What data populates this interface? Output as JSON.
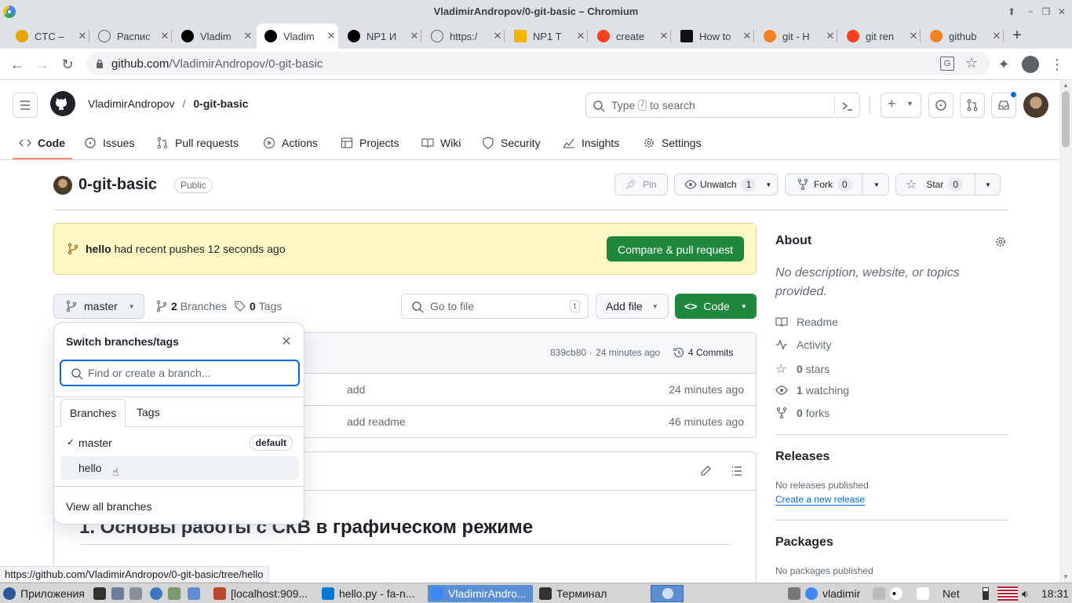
{
  "window": {
    "title": "VladimirAndropov/0-git-basic – Chromium"
  },
  "tabs": [
    {
      "label": "CTC –",
      "fav": "ctc",
      "color": "#e8a300"
    },
    {
      "label": "Распис",
      "fav": "globe",
      "color": "#5f6368"
    },
    {
      "label": "Vladim",
      "fav": "github",
      "color": "#000"
    },
    {
      "label": "Vladim",
      "fav": "github",
      "color": "#000",
      "active": true
    },
    {
      "label": "NP1 И",
      "fav": "t",
      "color": "#000"
    },
    {
      "label": "https:/",
      "fav": "globe",
      "color": "#5f6368"
    },
    {
      "label": "NP1 T",
      "fav": "slides",
      "color": "#f4b400"
    },
    {
      "label": "create",
      "fav": "ya",
      "color": "#fc3f1d"
    },
    {
      "label": "How to",
      "fav": "c",
      "color": "#111"
    },
    {
      "label": "git - H",
      "fav": "so",
      "color": "#f48024"
    },
    {
      "label": "git ren",
      "fav": "ya",
      "color": "#fc3f1d"
    },
    {
      "label": "github",
      "fav": "so",
      "color": "#f48024"
    }
  ],
  "browser": {
    "url_domain": "github.com",
    "url_path": "/VladimirAndropov/0-git-basic"
  },
  "header": {
    "owner": "VladimirAndropov",
    "slash": "/",
    "repo": "0-git-basic",
    "search_prefix": "Type",
    "search_key": "/",
    "search_suffix": "to search"
  },
  "nav": [
    "Code",
    "Issues",
    "Pull requests",
    "Actions",
    "Projects",
    "Wiki",
    "Security",
    "Insights",
    "Settings"
  ],
  "repo": {
    "name": "0-git-basic",
    "visibility": "Public",
    "pin": "Pin",
    "unwatch": "Unwatch",
    "watch_count": "1",
    "fork": "Fork",
    "fork_count": "0",
    "star": "Star",
    "star_count": "0"
  },
  "banner": {
    "branch": "hello",
    "text": "had recent pushes 12 seconds ago",
    "button": "Compare & pull request"
  },
  "toolbar": {
    "branch": "master",
    "branches_count": "2",
    "branches_label": "Branches",
    "tags_count": "0",
    "tags_label": "Tags",
    "goto_placeholder": "Go to file",
    "goto_key": "t",
    "add_file": "Add file",
    "code": "Code"
  },
  "commit": {
    "hash": "839cb80",
    "sep": "·",
    "time": "24 minutes ago",
    "commits": "4 Commits"
  },
  "files": [
    {
      "message": "add",
      "time": "24 minutes ago"
    },
    {
      "message": "add readme",
      "time": "46 minutes ago"
    }
  ],
  "readme": {
    "heading": "1. Основы работы с СКВ в графическом режиме"
  },
  "popover": {
    "title": "Switch branches/tags",
    "search_placeholder": "Find or create a branch...",
    "tab_branches": "Branches",
    "tab_tags": "Tags",
    "branches": [
      {
        "name": "master",
        "checked": true,
        "badge": "default"
      },
      {
        "name": "hello",
        "checked": false,
        "badge": ""
      }
    ],
    "view_all": "View all branches"
  },
  "about": {
    "title": "About",
    "desc": "No description, website, or topics provided.",
    "readme": "Readme",
    "activity": "Activity",
    "stars_count": "0",
    "stars_label": "stars",
    "watching_count": "1",
    "watching_label": "watching",
    "forks_count": "0",
    "forks_label": "forks"
  },
  "releases": {
    "title": "Releases",
    "none": "No releases published",
    "link": "Create a new release"
  },
  "packages": {
    "title": "Packages",
    "none": "No packages published"
  },
  "status_url": "https://github.com/VladimirAndropov/0-git-basic/tree/hello",
  "taskbar": {
    "apps": "Приложения",
    "items": [
      "[localhost:909...",
      "hello.py - fa-n...",
      "VladimirAndro...",
      "Терминал"
    ],
    "user": "vladimir",
    "net": "Net",
    "clock": "18:31"
  },
  "colors": {
    "accent": "#0969da",
    "primary_green": "#1f883d",
    "banner_bg": "#fff8c5",
    "underline": "#fd8c73"
  }
}
